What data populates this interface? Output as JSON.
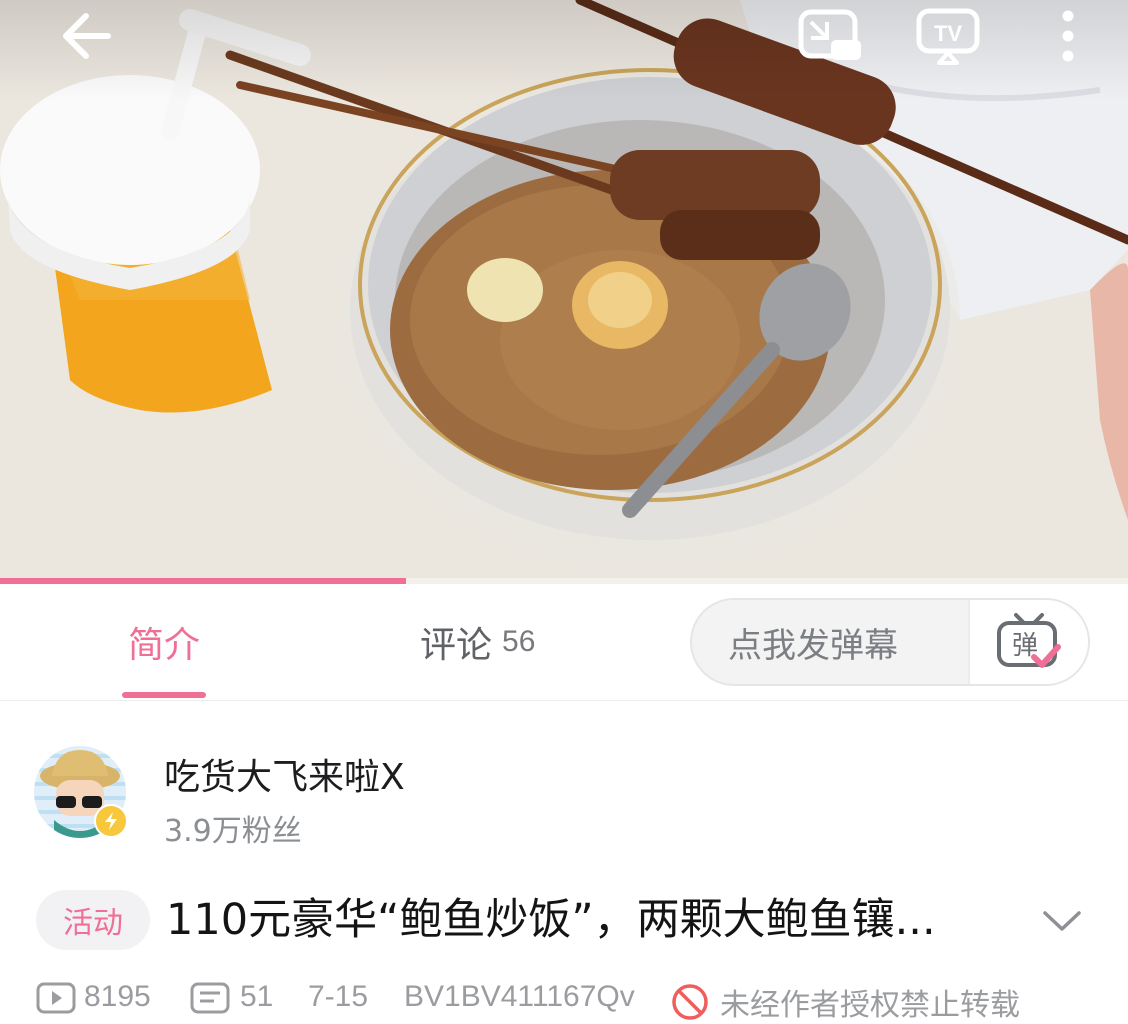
{
  "tabs": {
    "intro_label": "简介",
    "comments_label": "评论",
    "comments_count": "56",
    "active": "简介"
  },
  "danmaku": {
    "placeholder": "点我发弹幕",
    "toggle_icon": "danmaku-toggle-icon"
  },
  "player": {
    "progress_fraction": 0.36,
    "icons": [
      "back-arrow-icon",
      "picture-in-picture-icon",
      "tv-cast-icon",
      "more-vertical-icon"
    ]
  },
  "uploader": {
    "name": "吃货大飞来啦X",
    "fans": "3.9万粉丝"
  },
  "video": {
    "badge": "活动",
    "title": "110元豪华“鲍鱼炒饭”，两颗大鲍鱼镶..."
  },
  "meta": {
    "views": "8195",
    "danmaku_count": "51",
    "date": "7-15",
    "bvid": "BV1BV411167Qv",
    "copyright": "未经作者授权禁止转载"
  },
  "colors": {
    "accent": "#f06f97",
    "text_primary": "#141414",
    "text_secondary": "#8b8e93"
  }
}
